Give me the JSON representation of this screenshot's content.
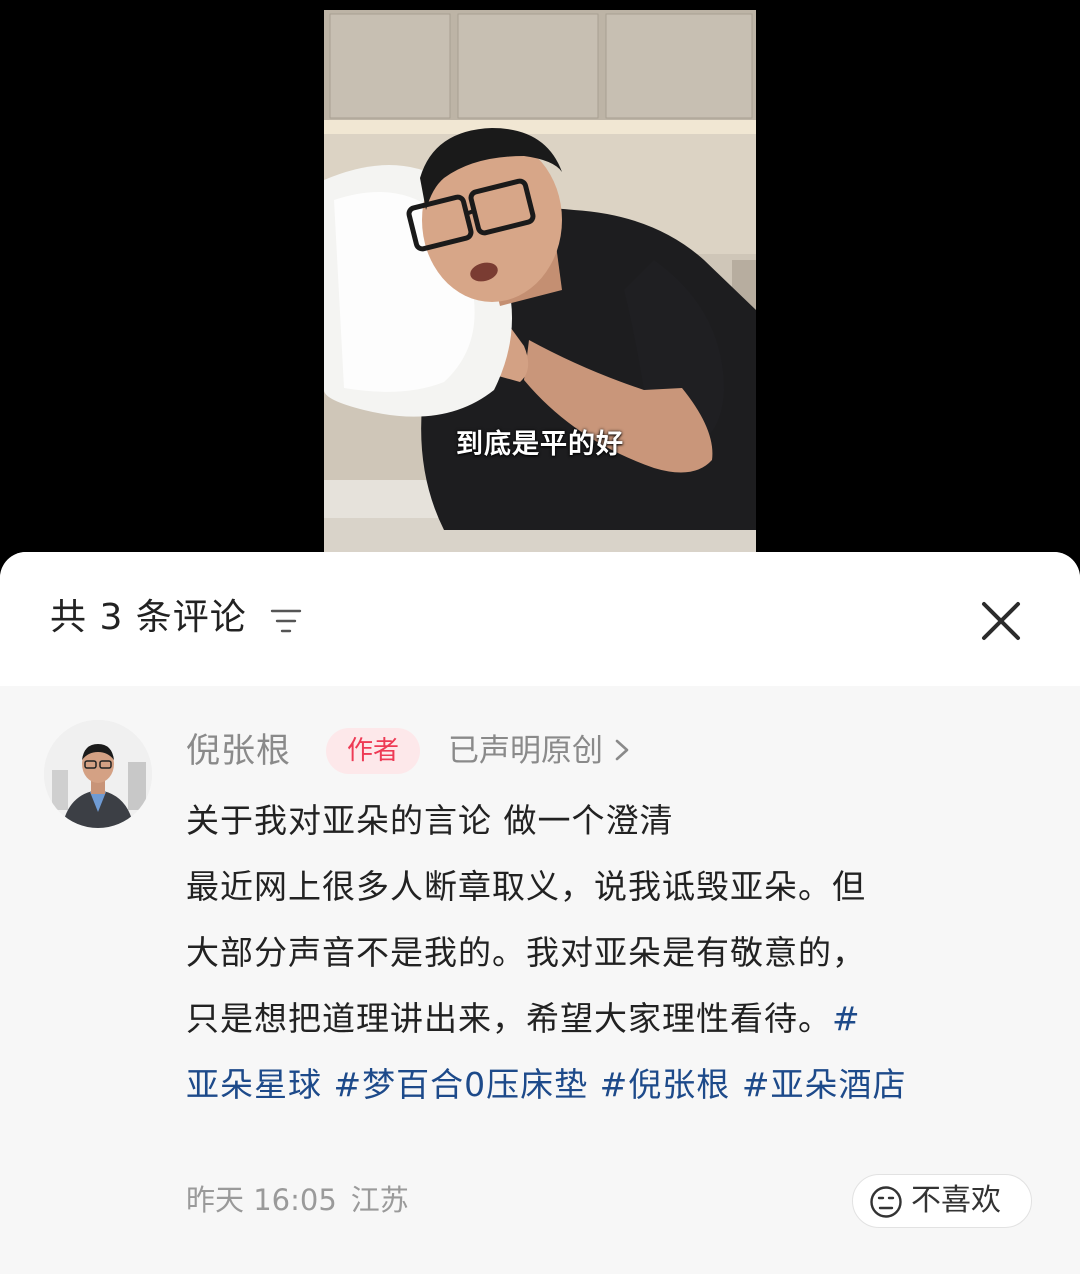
{
  "video": {
    "subtitle": "到底是平的好"
  },
  "comments_panel": {
    "title": "共 3 条评论",
    "icons": {
      "sort": "sort-icon",
      "close": "close-icon"
    },
    "comment": {
      "author": "倪张根",
      "author_badge": "作者",
      "original_label": "已声明原创",
      "lines": [
        "关于我对亚朵的言论 做一个澄清",
        "最近网上很多人断章取义，说我诋毁亚朵。但",
        "大部分声音不是我的。我对亚朵是有敬意的，",
        "只是想把道理讲出来，希望大家理性看待。"
      ],
      "hashtags": [
        "#",
        "亚朵星球",
        "#梦百合0压床垫",
        "#倪张根",
        "#亚朵酒店"
      ],
      "date": "昨天 16:05",
      "location": "江苏",
      "dislike_label": "不喜欢"
    }
  },
  "colors": {
    "badge_bg": "#fde8ea",
    "badge_text": "#ee3a55",
    "hashtag": "#1d4a8a",
    "sheet_bg": "#f7f7f7"
  }
}
